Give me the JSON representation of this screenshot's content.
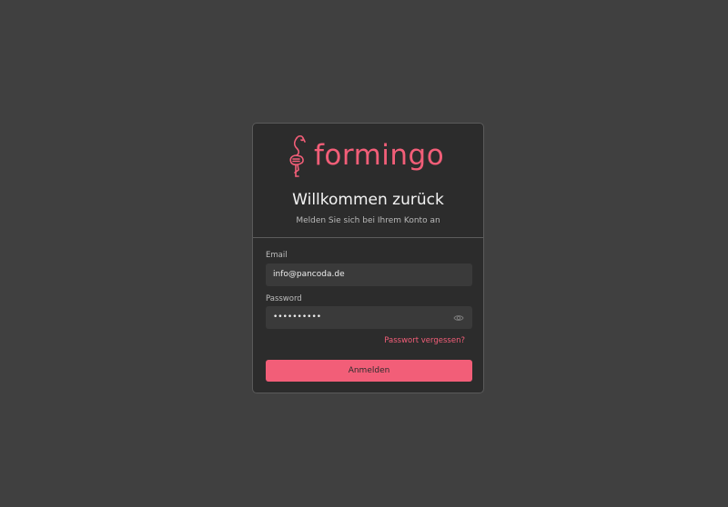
{
  "brand": {
    "name": "formingo",
    "accent": "#f25e78",
    "logo_icon": "flamingo-icon"
  },
  "login": {
    "title": "Willkommen zurück",
    "subtitle": "Melden Sie sich bei Ihrem Konto an",
    "email": {
      "label": "Email",
      "value": "info@pancoda.de"
    },
    "password": {
      "label": "Password",
      "value": "••••••••••",
      "toggle_icon": "eye-icon"
    },
    "forgot_link": "Passwort vergessen?",
    "submit_label": "Anmelden"
  }
}
